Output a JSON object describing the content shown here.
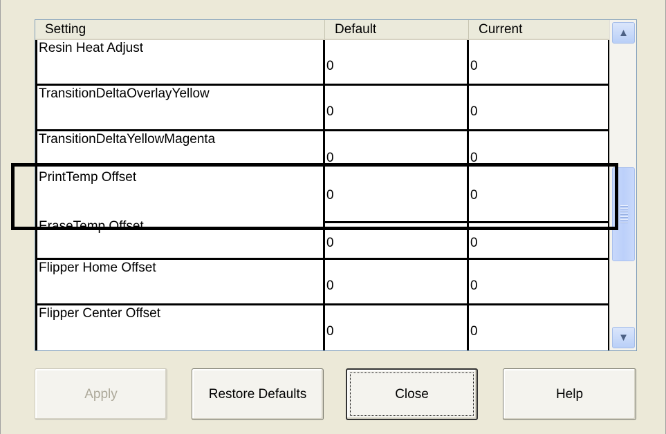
{
  "table": {
    "columns": [
      "Setting",
      "Default",
      "Current"
    ],
    "rows": [
      {
        "setting": "Resin Heat Adjust",
        "default": "0",
        "current": "0"
      },
      {
        "setting": "TransitionDeltaOverlayYellow",
        "default": "0",
        "current": "0"
      },
      {
        "setting": "TransitionDeltaYellowMagenta",
        "default": "0",
        "current": "0"
      },
      {
        "setting": "",
        "default": "",
        "current": ""
      },
      {
        "setting": "PrintTemp Offset",
        "default": "0",
        "current": "0"
      },
      {
        "setting": "EraseTemp Offset",
        "default": "0",
        "current": "0"
      },
      {
        "setting": "Flipper Home Offset",
        "default": "0",
        "current": "0"
      },
      {
        "setting": "Flipper Center Offset",
        "default": "0",
        "current": "0"
      }
    ]
  },
  "scrollbar": {
    "up_icon": "▲",
    "down_icon": "▼"
  },
  "buttons": {
    "apply": "Apply",
    "restore_defaults": "Restore Defaults",
    "close": "Close",
    "help": "Help"
  }
}
